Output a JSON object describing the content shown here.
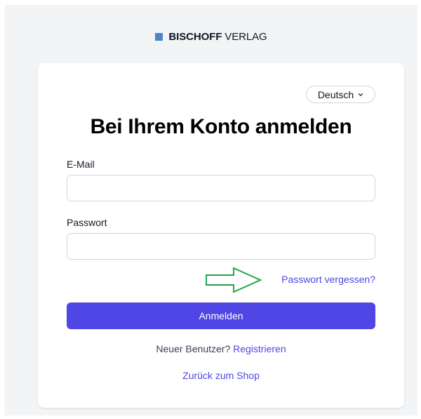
{
  "brand": {
    "name_bold": "BISCHOFF",
    "name_light": "VERLAG",
    "color": "#4a86c5"
  },
  "language": {
    "selected": "Deutsch",
    "icon": "chevron-down-icon"
  },
  "login": {
    "title": "Bei Ihrem Konto anmelden",
    "email_label": "E-Mail",
    "email_value": "",
    "password_label": "Passwort",
    "password_value": "",
    "forgot_password": "Passwort vergessen?",
    "submit_label": "Anmelden",
    "new_user_text": "Neuer Benutzer?",
    "register_link": "Registrieren",
    "back_link": "Zurück zum Shop"
  },
  "annotation": {
    "icon": "arrow-right-icon",
    "color": "#22a34a"
  },
  "colors": {
    "accent": "#4f46e5",
    "background": "#f3f4f6"
  }
}
